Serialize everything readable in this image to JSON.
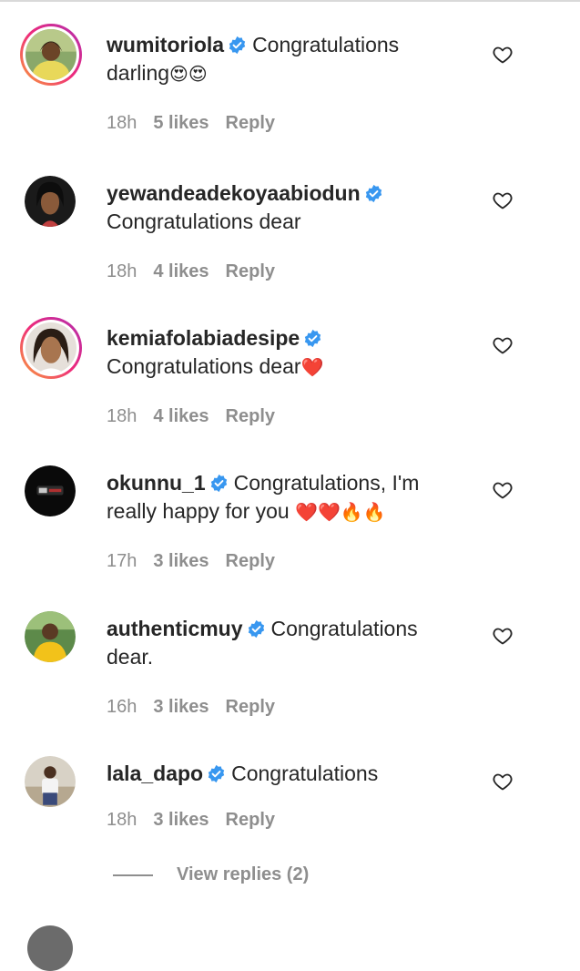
{
  "comments": [
    {
      "username": "wumitoriola",
      "verified": true,
      "text": "Congratulations darling",
      "emoji": "😍😍",
      "time": "18h",
      "likes": "5 likes",
      "reply": "Reply",
      "story_ring": true
    },
    {
      "username": "yewandeadekoyaabiodun",
      "verified": true,
      "text": "Congratulations dear",
      "emoji": "",
      "time": "18h",
      "likes": "4 likes",
      "reply": "Reply",
      "story_ring": false
    },
    {
      "username": "kemiafolabiadesipe",
      "verified": true,
      "text": "Congratulations dear",
      "emoji": "❤️",
      "time": "18h",
      "likes": "4 likes",
      "reply": "Reply",
      "story_ring": true
    },
    {
      "username": "okunnu_1",
      "verified": true,
      "text": "Congratulations, I'm really happy for you",
      "emoji": "❤️❤️🔥🔥",
      "time": "17h",
      "likes": "3 likes",
      "reply": "Reply",
      "story_ring": false
    },
    {
      "username": "authenticmuy",
      "verified": true,
      "text": "Congratulations dear.",
      "emoji": "",
      "time": "16h",
      "likes": "3 likes",
      "reply": "Reply",
      "story_ring": false
    },
    {
      "username": "lala_dapo",
      "verified": true,
      "text": "Congratulations",
      "emoji": "",
      "time": "18h",
      "likes": "3 likes",
      "reply": "Reply",
      "story_ring": false
    }
  ],
  "view_replies": "View replies (2)",
  "icons": {
    "verified": "verified-badge-icon",
    "like": "heart-outline-icon"
  },
  "colors": {
    "verified_blue": "#3897f0",
    "meta_gray": "#8e8e8e",
    "text": "#262626"
  }
}
